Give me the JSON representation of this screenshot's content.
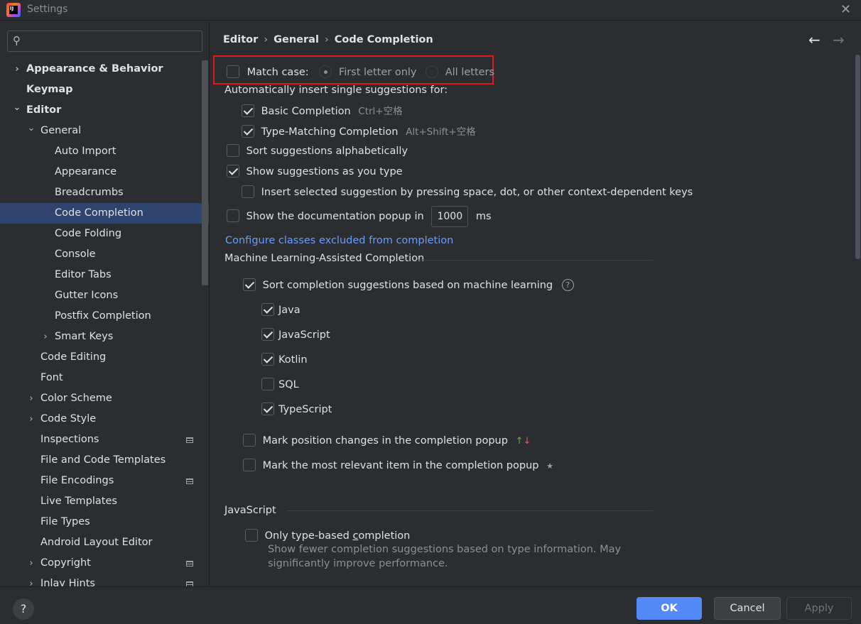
{
  "window": {
    "title": "Settings",
    "close_glyph": "✕",
    "logo_text": "IJ"
  },
  "search": {
    "placeholder": "",
    "icon": "search-icon"
  },
  "sidebar": {
    "items": [
      {
        "label": "Appearance & Behavior",
        "level": 0,
        "bold": true,
        "chevron": "right"
      },
      {
        "label": "Keymap",
        "level": 0,
        "bold": true,
        "chevron": ""
      },
      {
        "label": "Editor",
        "level": 0,
        "bold": true,
        "chevron": "down"
      },
      {
        "label": "General",
        "level": 1,
        "bold": false,
        "chevron": "down"
      },
      {
        "label": "Auto Import",
        "level": 2,
        "bold": false,
        "chevron": ""
      },
      {
        "label": "Appearance",
        "level": 2,
        "bold": false,
        "chevron": ""
      },
      {
        "label": "Breadcrumbs",
        "level": 2,
        "bold": false,
        "chevron": ""
      },
      {
        "label": "Code Completion",
        "level": 2,
        "bold": false,
        "chevron": "",
        "selected": true
      },
      {
        "label": "Code Folding",
        "level": 2,
        "bold": false,
        "chevron": ""
      },
      {
        "label": "Console",
        "level": 2,
        "bold": false,
        "chevron": ""
      },
      {
        "label": "Editor Tabs",
        "level": 2,
        "bold": false,
        "chevron": ""
      },
      {
        "label": "Gutter Icons",
        "level": 2,
        "bold": false,
        "chevron": ""
      },
      {
        "label": "Postfix Completion",
        "level": 2,
        "bold": false,
        "chevron": ""
      },
      {
        "label": "Smart Keys",
        "level": 2,
        "bold": false,
        "chevron": "right"
      },
      {
        "label": "Code Editing",
        "level": 1,
        "bold": false,
        "chevron": ""
      },
      {
        "label": "Font",
        "level": 1,
        "bold": false,
        "chevron": ""
      },
      {
        "label": "Color Scheme",
        "level": 1,
        "bold": false,
        "chevron": "right"
      },
      {
        "label": "Code Style",
        "level": 1,
        "bold": false,
        "chevron": "right"
      },
      {
        "label": "Inspections",
        "level": 1,
        "bold": false,
        "chevron": "",
        "project_icon": true
      },
      {
        "label": "File and Code Templates",
        "level": 1,
        "bold": false,
        "chevron": ""
      },
      {
        "label": "File Encodings",
        "level": 1,
        "bold": false,
        "chevron": "",
        "project_icon": true
      },
      {
        "label": "Live Templates",
        "level": 1,
        "bold": false,
        "chevron": ""
      },
      {
        "label": "File Types",
        "level": 1,
        "bold": false,
        "chevron": ""
      },
      {
        "label": "Android Layout Editor",
        "level": 1,
        "bold": false,
        "chevron": ""
      },
      {
        "label": "Copyright",
        "level": 1,
        "bold": false,
        "chevron": "right",
        "project_icon": true
      },
      {
        "label": "Inlay Hints",
        "level": 1,
        "bold": false,
        "chevron": "right",
        "project_icon": true
      }
    ]
  },
  "breadcrumb": {
    "parts": [
      "Editor",
      "General",
      "Code Completion"
    ],
    "separator": "›"
  },
  "nav": {
    "back": "←",
    "forward": "→"
  },
  "main": {
    "match_case": {
      "label": "Match case:",
      "checked": false,
      "option1": "First letter only",
      "option2": "All letters",
      "selected": "First letter only"
    },
    "auto_insert_label": "Automatically insert single suggestions for:",
    "basic_completion": {
      "label": "Basic Completion",
      "shortcut": "Ctrl+空格",
      "checked": true
    },
    "type_matching": {
      "label": "Type-Matching Completion",
      "shortcut": "Alt+Shift+空格",
      "checked": true
    },
    "sort_alpha": {
      "label": "Sort suggestions alphabetically",
      "checked": false
    },
    "show_as_type": {
      "label": "Show suggestions as you type",
      "checked": true
    },
    "insert_selected": {
      "label": "Insert selected suggestion by pressing space, dot, or other context-dependent keys",
      "checked": false
    },
    "doc_popup": {
      "label": "Show the documentation popup in",
      "value": "1000",
      "unit": "ms",
      "checked": false
    },
    "configure_link": "Configure classes excluded from completion",
    "ml_section": "Machine Learning-Assisted Completion",
    "ml_sort": {
      "label": "Sort completion suggestions based on machine learning",
      "checked": true,
      "help": "?"
    },
    "languages": [
      {
        "label": "Java",
        "checked": true
      },
      {
        "label": "JavaScript",
        "checked": true
      },
      {
        "label": "Kotlin",
        "checked": true
      },
      {
        "label": "SQL",
        "checked": false
      },
      {
        "label": "TypeScript",
        "checked": true
      }
    ],
    "mark_position": {
      "label": "Mark position changes in the completion popup",
      "checked": false
    },
    "mark_relevant": {
      "label": "Mark the most relevant item in the completion popup",
      "checked": false
    },
    "js_section": "JavaScript",
    "type_based": {
      "label_before": "Only type-based ",
      "label_ul": "c",
      "label_after": "ompletion",
      "checked": false
    },
    "type_based_desc_1": "Show fewer completion suggestions based on type information. May",
    "type_based_desc_2": "significantly improve performance."
  },
  "footer": {
    "help": "?",
    "ok": "OK",
    "cancel": "Cancel",
    "apply": "Apply"
  },
  "colors": {
    "accent": "#548af7",
    "selected_row": "#2e436e",
    "highlight": "#e3191a",
    "link": "#6b9ef7"
  }
}
